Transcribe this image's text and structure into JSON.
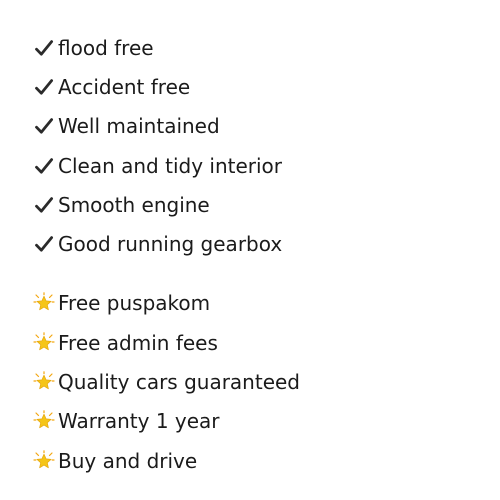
{
  "features": {
    "items": [
      {
        "icon": "check-mark-icon",
        "label": "flood free"
      },
      {
        "icon": "check-mark-icon",
        "label": "Accident free"
      },
      {
        "icon": "check-mark-icon",
        "label": "Well maintained"
      },
      {
        "icon": "check-mark-icon",
        "label": "Clean and tidy interior"
      },
      {
        "icon": "check-mark-icon",
        "label": "Smooth engine"
      },
      {
        "icon": "check-mark-icon",
        "label": "Good running gearbox"
      }
    ]
  },
  "benefits": {
    "items": [
      {
        "icon": "glowing-star-icon",
        "label": "Free puspakom"
      },
      {
        "icon": "glowing-star-icon",
        "label": "Free admin fees"
      },
      {
        "icon": "glowing-star-icon",
        "label": "Quality cars guaranteed"
      },
      {
        "icon": "glowing-star-icon",
        "label": "Warranty 1 year"
      },
      {
        "icon": "glowing-star-icon",
        "label": "Buy and drive"
      }
    ]
  },
  "colors": {
    "text": "#1b1b1b",
    "check": "#2b2b2b",
    "star": "#f5c518",
    "star_glow": "#f3a712"
  }
}
